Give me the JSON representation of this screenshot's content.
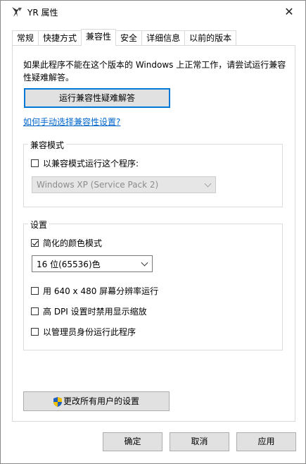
{
  "window": {
    "title": "YR 属性",
    "close_glyph": "✕"
  },
  "tabs": [
    {
      "label": "常规"
    },
    {
      "label": "快捷方式"
    },
    {
      "label": "兼容性",
      "active": true
    },
    {
      "label": "安全"
    },
    {
      "label": "详细信息"
    },
    {
      "label": "以前的版本"
    }
  ],
  "compat": {
    "intro": "如果此程序不能在这个版本的 Windows 上正常工作，请尝试运行兼容性疑难解答。",
    "troubleshoot_button": "运行兼容性疑难解答",
    "manual_link": "如何手动选择兼容性设置?",
    "mode_group": {
      "label": "兼容模式",
      "checkbox_label": "以兼容模式运行这个程序:",
      "checked": false,
      "os_select_value": "Windows XP (Service Pack 2)"
    },
    "settings_group": {
      "label": "设置",
      "reduced_color": {
        "label": "简化的颜色模式",
        "checked": true
      },
      "color_select_value": "16 位(65536)色",
      "res_640": {
        "label": "用 640 x 480 屏幕分辨率运行",
        "checked": false
      },
      "dpi": {
        "label": "高 DPI 设置时禁用显示缩放",
        "checked": false
      },
      "admin": {
        "label": "以管理员身份运行此程序",
        "checked": false
      }
    },
    "change_all_button": "更改所有用户的设置"
  },
  "footer": {
    "ok": "确定",
    "cancel": "取消",
    "apply": "应用"
  },
  "icons": {
    "app": "yr-app-icon",
    "shield": "uac-shield-icon",
    "close": "close-icon"
  },
  "colors": {
    "focus_border": "#0078d7",
    "link": "#0066cc",
    "button_bg": "#e1e1e1"
  }
}
